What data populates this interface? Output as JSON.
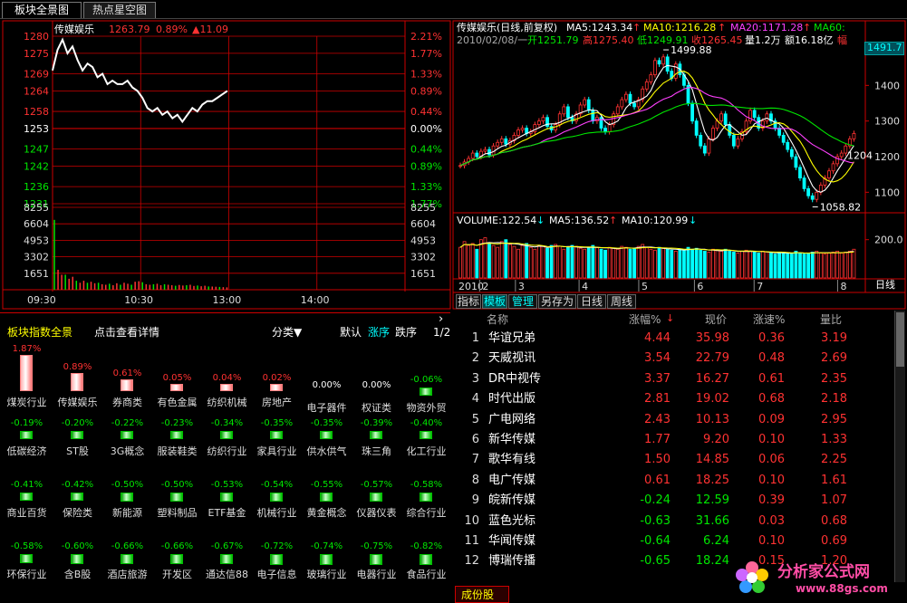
{
  "tabs": [
    "板块全景图",
    "热点星空图"
  ],
  "intraday": {
    "name": "传媒娱乐",
    "price": "1263.79",
    "pct": "0.89%",
    "change": "▲11.09",
    "price_levels": [
      "1280",
      "1275",
      "1269",
      "1264",
      "1258",
      "1253",
      "1247",
      "1242",
      "1236",
      "1231"
    ],
    "pct_levels": [
      "2.21%",
      "1.77%",
      "1.33%",
      "0.89%",
      "0.44%",
      "0.00%",
      "0.44%",
      "0.89%",
      "1.33%",
      "1.77%"
    ],
    "vol_levels": [
      "8255",
      "6604",
      "4953",
      "3302",
      "1651"
    ],
    "times": [
      "09:30",
      "10:30",
      "13:00",
      "14:00"
    ],
    "line": [
      1270,
      1276,
      1279,
      1275,
      1277,
      1273,
      1270,
      1272,
      1271,
      1268,
      1269,
      1266,
      1267,
      1266,
      1266,
      1267,
      1265,
      1264,
      1262,
      1259,
      1258,
      1259,
      1257,
      1258,
      1256,
      1257,
      1255,
      1257,
      1259,
      1258,
      1260,
      1261,
      1261,
      1262,
      1263,
      1264
    ],
    "volumes": [
      7000,
      2000,
      1500,
      1500,
      1100,
      1300,
      900,
      700,
      900,
      700,
      800,
      650,
      700,
      550,
      500,
      600,
      450,
      650,
      500,
      700,
      600,
      500,
      800,
      850,
      750,
      550,
      500,
      550,
      600,
      450,
      550,
      500,
      450,
      400,
      480,
      420,
      450,
      500,
      380,
      420,
      350,
      400,
      330,
      320,
      300,
      280,
      260,
      240
    ]
  },
  "daily": {
    "title": "传媒娱乐(日线,前复权)",
    "ma5": "MA5:1243.34",
    "ma10": "MA10:1216.28",
    "ma20": "MA20:1171.28",
    "ma60": "MA60:",
    "info_date": "2010/02/08/一",
    "info_open": "开1251.79",
    "info_high": "高1275.40",
    "info_low": "低1249.91",
    "info_close": "收1265.45",
    "info_vol": "量1.2万",
    "info_amt": "额16.18亿",
    "info_rise": "幅",
    "cur_price": "1491.7",
    "price_axis": [
      "1400",
      "1300",
      "1200",
      "1100"
    ],
    "hi_label": "1499.88",
    "lo_label": "1058.82",
    "last_label": "1204",
    "volume_title": "VOLUME:122.54",
    "vol_ma5": "MA5:136.52",
    "vol_ma10": "MA10:120.99",
    "vol_axis": "200.0",
    "date_labels": [
      "2010",
      "2",
      "3",
      "4",
      "5",
      "6",
      "7",
      "8"
    ],
    "cycle_label": "日线",
    "bottom_tabs": [
      "指标",
      "模板",
      "管理",
      "另存为",
      "日线",
      "周线"
    ],
    "closes": [
      1175,
      1185,
      1195,
      1210,
      1200,
      1215,
      1220,
      1205,
      1230,
      1240,
      1250,
      1235,
      1245,
      1260,
      1275,
      1280,
      1265,
      1270,
      1290,
      1300,
      1310,
      1285,
      1275,
      1290,
      1320,
      1340,
      1310,
      1300,
      1320,
      1345,
      1360,
      1330,
      1300,
      1310,
      1280,
      1270,
      1290,
      1320,
      1340,
      1360,
      1375,
      1350,
      1340,
      1360,
      1390,
      1410,
      1430,
      1470,
      1460,
      1480,
      1440,
      1420,
      1460,
      1430,
      1400,
      1350,
      1300,
      1260,
      1230,
      1210,
      1250,
      1280,
      1300,
      1320,
      1290,
      1260,
      1230,
      1250,
      1270,
      1300,
      1330,
      1310,
      1280,
      1300,
      1320,
      1300,
      1280,
      1260,
      1240,
      1220,
      1200,
      1170,
      1140,
      1110,
      1090,
      1080,
      1100,
      1120,
      1140,
      1160,
      1180,
      1200,
      1210,
      1230,
      1250,
      1265
    ],
    "volumes": [
      160,
      190,
      170,
      180,
      150,
      200,
      210,
      185,
      170,
      160,
      190,
      200,
      175,
      165,
      150,
      170,
      180,
      160,
      150,
      170,
      165,
      155,
      170,
      175,
      165,
      150,
      160,
      170,
      165,
      155,
      150,
      160,
      170,
      160,
      150,
      145,
      160,
      155,
      150,
      165,
      160,
      150,
      155,
      165,
      175,
      160,
      150,
      145,
      160,
      155,
      150,
      145,
      140,
      150,
      145,
      160,
      150,
      155,
      145,
      140,
      135,
      150,
      145,
      140,
      150,
      140,
      135,
      130,
      140,
      145,
      140,
      135,
      130,
      140,
      135,
      130,
      125,
      130,
      135,
      130,
      125,
      140,
      130,
      125,
      130,
      135,
      140,
      130,
      125,
      130,
      135,
      140,
      130,
      135,
      140,
      150
    ]
  },
  "sector": {
    "title": "板块指数全景",
    "detail": "点击查看详情",
    "category": "分类▼",
    "sort_default": "默认",
    "sort_up": "涨序",
    "sort_down": "跌序",
    "page": "1/2",
    "items": [
      {
        "name": "煤炭行业",
        "pct": "1.87%",
        "v": 1.87
      },
      {
        "name": "传媒娱乐",
        "pct": "0.89%",
        "v": 0.89
      },
      {
        "name": "券商类",
        "pct": "0.61%",
        "v": 0.61
      },
      {
        "name": "有色金属",
        "pct": "0.05%",
        "v": 0.05
      },
      {
        "name": "纺织机械",
        "pct": "0.04%",
        "v": 0.04
      },
      {
        "name": "房地产",
        "pct": "0.02%",
        "v": 0.02
      },
      {
        "name": "电子器件",
        "pct": "0.00%",
        "v": 0
      },
      {
        "name": "权证类",
        "pct": "0.00%",
        "v": 0
      },
      {
        "name": "物资外贸",
        "pct": "-0.06%",
        "v": -0.06
      },
      {
        "name": "低碳经济",
        "pct": "-0.19%",
        "v": -0.19
      },
      {
        "name": "ST股",
        "pct": "-0.20%",
        "v": -0.2
      },
      {
        "name": "3G概念",
        "pct": "-0.22%",
        "v": -0.22
      },
      {
        "name": "服装鞋类",
        "pct": "-0.23%",
        "v": -0.23
      },
      {
        "name": "纺织行业",
        "pct": "-0.34%",
        "v": -0.34
      },
      {
        "name": "家具行业",
        "pct": "-0.35%",
        "v": -0.35
      },
      {
        "name": "供水供气",
        "pct": "-0.35%",
        "v": -0.35
      },
      {
        "name": "珠三角",
        "pct": "-0.39%",
        "v": -0.39
      },
      {
        "name": "化工行业",
        "pct": "-0.40%",
        "v": -0.4
      },
      {
        "name": "商业百货",
        "pct": "-0.41%",
        "v": -0.41
      },
      {
        "name": "保险类",
        "pct": "-0.42%",
        "v": -0.42
      },
      {
        "name": "新能源",
        "pct": "-0.50%",
        "v": -0.5
      },
      {
        "name": "塑料制品",
        "pct": "-0.50%",
        "v": -0.5
      },
      {
        "name": "ETF基金",
        "pct": "-0.53%",
        "v": -0.53
      },
      {
        "name": "机械行业",
        "pct": "-0.54%",
        "v": -0.54
      },
      {
        "name": "黄金概念",
        "pct": "-0.55%",
        "v": -0.55
      },
      {
        "name": "仪器仪表",
        "pct": "-0.57%",
        "v": -0.57
      },
      {
        "name": "综合行业",
        "pct": "-0.58%",
        "v": -0.58
      },
      {
        "name": "环保行业",
        "pct": "-0.58%",
        "v": -0.58
      },
      {
        "name": "含B股",
        "pct": "-0.60%",
        "v": -0.6
      },
      {
        "name": "酒店旅游",
        "pct": "-0.66%",
        "v": -0.66
      },
      {
        "name": "开发区",
        "pct": "-0.66%",
        "v": -0.66
      },
      {
        "name": "通达信88",
        "pct": "-0.67%",
        "v": -0.67
      },
      {
        "name": "电子信息",
        "pct": "-0.72%",
        "v": -0.72
      },
      {
        "name": "玻璃行业",
        "pct": "-0.74%",
        "v": -0.74
      },
      {
        "name": "电器行业",
        "pct": "-0.75%",
        "v": -0.75
      },
      {
        "name": "食品行业",
        "pct": "-0.82%",
        "v": -0.82
      }
    ]
  },
  "ranking": {
    "headers": [
      "名称",
      "涨幅%",
      "现价",
      "涨速%",
      "量比"
    ],
    "rows": [
      {
        "no": "1",
        "name": "华谊兄弟",
        "pct": "4.44",
        "price": "35.98",
        "speed": "0.36",
        "ratio": "3.19",
        "up": true
      },
      {
        "no": "2",
        "name": "天威视讯",
        "pct": "3.54",
        "price": "22.79",
        "speed": "0.48",
        "ratio": "2.69",
        "up": true
      },
      {
        "no": "3",
        "name": "DR中视传",
        "pct": "3.37",
        "price": "16.27",
        "speed": "0.61",
        "ratio": "2.35",
        "up": true
      },
      {
        "no": "4",
        "name": "时代出版",
        "pct": "2.81",
        "price": "19.02",
        "speed": "0.68",
        "ratio": "2.18",
        "up": true
      },
      {
        "no": "5",
        "name": "广电网络",
        "pct": "2.43",
        "price": "10.13",
        "speed": "0.09",
        "ratio": "2.95",
        "up": true
      },
      {
        "no": "6",
        "name": "新华传媒",
        "pct": "1.77",
        "price": "9.20",
        "speed": "0.10",
        "ratio": "1.33",
        "up": true
      },
      {
        "no": "7",
        "name": "歌华有线",
        "pct": "1.50",
        "price": "14.85",
        "speed": "0.06",
        "ratio": "2.25",
        "up": true
      },
      {
        "no": "8",
        "name": "电广传媒",
        "pct": "0.61",
        "price": "18.25",
        "speed": "0.10",
        "ratio": "1.61",
        "up": true
      },
      {
        "no": "9",
        "name": "皖新传媒",
        "pct": "-0.24",
        "price": "12.59",
        "speed": "0.39",
        "ratio": "1.07",
        "up": false
      },
      {
        "no": "10",
        "name": "蓝色光标",
        "pct": "-0.63",
        "price": "31.66",
        "speed": "0.03",
        "ratio": "0.68",
        "up": false
      },
      {
        "no": "11",
        "name": "华闻传媒",
        "pct": "-0.64",
        "price": "6.24",
        "speed": "0.10",
        "ratio": "0.69",
        "up": false
      },
      {
        "no": "12",
        "name": "博瑞传播",
        "pct": "-0.65",
        "price": "18.24",
        "speed": "0.15",
        "ratio": "1.20",
        "up": false
      }
    ],
    "footer_tab": "成份股"
  },
  "watermark": {
    "brand": "分析家公式网",
    "url": "www.88gs.com"
  },
  "colors": {
    "up": "#ff3232",
    "down": "#00e600",
    "grid": "#cc0000",
    "bg": "#000000"
  }
}
